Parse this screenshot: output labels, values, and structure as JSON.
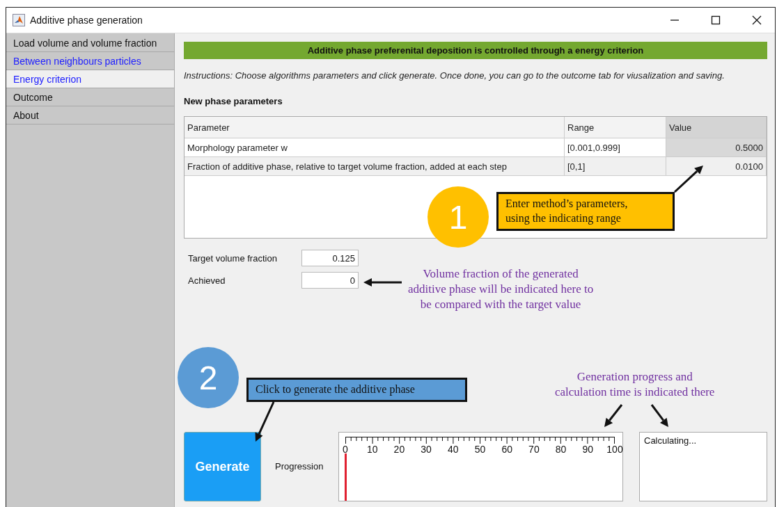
{
  "window": {
    "title": "Additive phase generation"
  },
  "sidebar": {
    "items": [
      {
        "label": "Load volume and volume fraction",
        "selected": false,
        "visited": false
      },
      {
        "label": "Between neighbours particles",
        "selected": false,
        "visited": true
      },
      {
        "label": "Energy criterion",
        "selected": true,
        "visited": true
      },
      {
        "label": "Outcome",
        "selected": false,
        "visited": false
      },
      {
        "label": "About",
        "selected": false,
        "visited": false
      }
    ]
  },
  "banner": "Additive phase preferenital deposition is controlled through a energy criterion",
  "instructions": "Instructions: Choose algorithms parameters and click generate. Once done, you can go to the outcome tab for viusalization and saving.",
  "section_title": "New phase parameters",
  "table": {
    "columns": [
      "Parameter",
      "Range",
      "Value"
    ],
    "rows": [
      {
        "cells": [
          "Morphology parameter w",
          "[0.001,0.999]",
          "0.5000"
        ],
        "selected": true
      },
      {
        "cells": [
          "Fraction of additive phase, relative to target volume fraction, added at each step",
          "[0,1]",
          "0.0100"
        ],
        "selected": false
      }
    ]
  },
  "fields": [
    {
      "label": "Target volume fraction",
      "value": "0.125"
    },
    {
      "label": "Achieved",
      "value": "0"
    }
  ],
  "generate_button": "Generate",
  "progress": {
    "label": "Progression",
    "ticks": [
      "0",
      "10",
      "20",
      "30",
      "40",
      "50",
      "60",
      "70",
      "80",
      "90",
      "100"
    ],
    "level": 0
  },
  "status_box": {
    "text": "Calculating..."
  },
  "annotations": [
    {
      "kind": "badge",
      "text": "1",
      "color": "#ffc000"
    },
    {
      "kind": "callout",
      "lines": [
        "Enter method’s parameters,",
        "using the indicating range"
      ],
      "color": "#ffc000"
    },
    {
      "kind": "note",
      "lines": [
        "Volume fraction of the generated",
        "additive phase will be indicated here to",
        "be compared with the target value"
      ],
      "color": "#7030a0"
    },
    {
      "kind": "badge",
      "text": "2",
      "color": "#5b9bd5"
    },
    {
      "kind": "callout",
      "lines": [
        "Click to generate the additive phase"
      ],
      "color": "#5b9bd5"
    },
    {
      "kind": "note",
      "lines": [
        "Generation progress and",
        "calculation time is indicated there"
      ],
      "color": "#7030a0"
    }
  ]
}
